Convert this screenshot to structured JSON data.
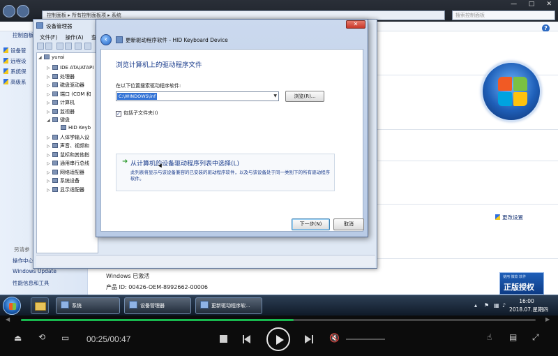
{
  "system_window": {
    "address_text": "控制面板 ▸ 所有控制面板项 ▸ 系统",
    "search_placeholder": "搜索控制面板",
    "window_buttons": [
      "—",
      "□",
      "✕"
    ],
    "help": "?",
    "left_links": [
      "控制面板",
      "设备管",
      "远程设",
      "系统保",
      "高级系"
    ],
    "see_also_title": "另请参",
    "see_also_links": [
      "操作中心",
      "Windows Update",
      "性能信息和工具"
    ],
    "change_settings": "更改设置",
    "activation": "Windows 已激活",
    "product_id": "产品 ID: 00426-OEM-8992662-00006",
    "genuine_top": "使用 微软 软件",
    "genuine_main": "正版授权"
  },
  "device_manager": {
    "title": "设备管理器",
    "menu": [
      "文件(F)",
      "操作(A)",
      "查看"
    ],
    "tree": [
      {
        "label": "yunsi",
        "level": 0
      },
      {
        "label": "IDE ATA/ATAPI",
        "level": 1
      },
      {
        "label": "处理器",
        "level": 1
      },
      {
        "label": "磁盘驱动器",
        "level": 1
      },
      {
        "label": "端口 (COM 和",
        "level": 1
      },
      {
        "label": "计算机",
        "level": 1
      },
      {
        "label": "监视器",
        "level": 1
      },
      {
        "label": "键盘",
        "level": 1
      },
      {
        "label": "HID Keyb",
        "level": 2
      },
      {
        "label": "人体学输入设",
        "level": 1
      },
      {
        "label": "声音、视频和",
        "level": 1
      },
      {
        "label": "鼠标和其他指",
        "level": 1
      },
      {
        "label": "通用串行总线",
        "level": 1
      },
      {
        "label": "网络适配器",
        "level": 1
      },
      {
        "label": "系统设备",
        "level": 1
      },
      {
        "label": "显示适配器",
        "level": 1
      }
    ]
  },
  "dialog": {
    "title": "更新驱动程序软件 - HID Keyboard Device",
    "close": "✕",
    "heading": "浏览计算机上的驱动程序文件",
    "search_label": "在以下位置搜索驱动程序软件:",
    "path_value": "C:\\WINDOWS\\inf",
    "browse_label": "浏览(R)...",
    "include_subfolders": "包括子文件夹(I)",
    "option_title": "从计算机的设备驱动程序列表中选择(L)",
    "option_desc": "此列表将显示与该设备兼容的已安装的驱动程序软件，以及与该设备处于同一类别下的所有驱动程序软件。",
    "next_label": "下一步(N)",
    "cancel_label": "取消"
  },
  "taskbar": {
    "tasks": [
      "系统",
      "设备管理器",
      "更新驱动程序软..."
    ],
    "time": "16:00",
    "date": "2018.07.星期四"
  },
  "player": {
    "current": "00:25",
    "total": "00:47",
    "progress": 0.53,
    "volume": 0.0,
    "arrow_left": "◀",
    "arrow_right": "▶",
    "accent_color": "#18b84e"
  }
}
